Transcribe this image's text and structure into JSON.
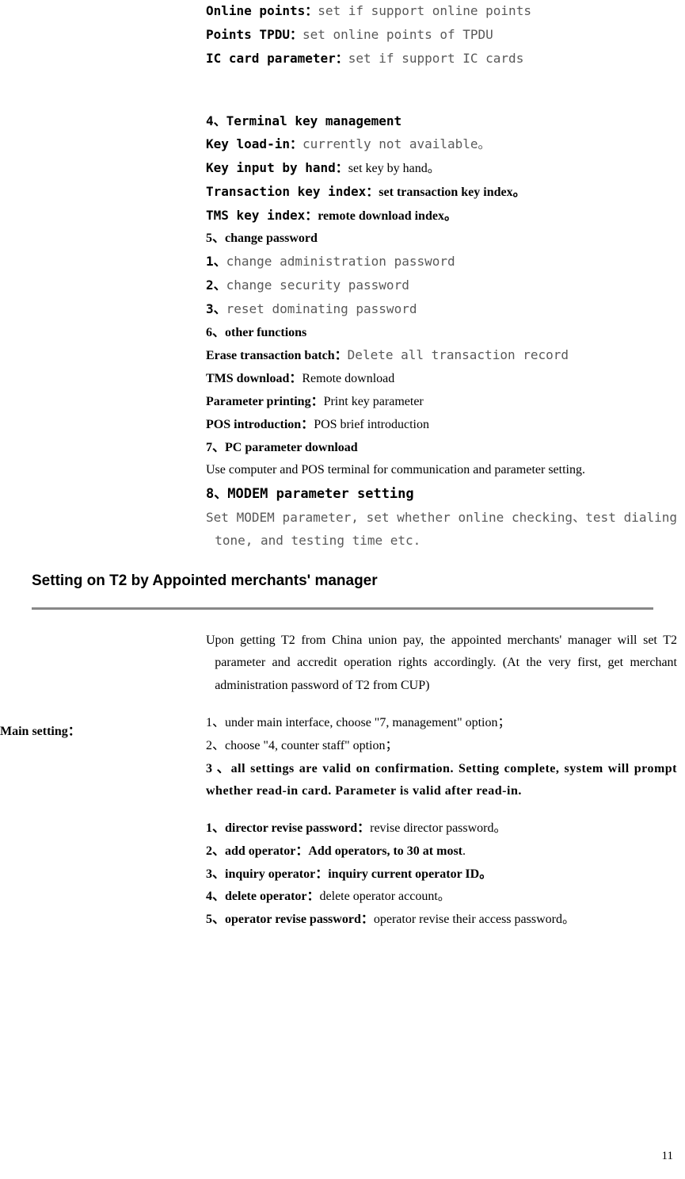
{
  "top": {
    "online_points_label": "Online points：",
    "online_points_desc": "set if support online points",
    "points_tpdu_label": "Points TPDU：",
    "points_tpdu_desc": "set online points of TPDU",
    "ic_card_label": "IC card parameter：",
    "ic_card_desc": "set if support IC cards"
  },
  "s4": {
    "heading": "4、Terminal key management",
    "key_loadin_label": "Key load-in：",
    "key_loadin_desc": "currently not available。",
    "key_input_label": "Key input by hand：",
    "key_input_desc": "set key by hand。",
    "txn_key_index_label": "Transaction key index：",
    "txn_key_index_desc": "set transaction key index。",
    "tms_key_index_label": "TMS key index：",
    "tms_key_index_desc": "remote download index。"
  },
  "s5": {
    "heading": "5、change password",
    "item1_num": "1、",
    "item1_desc": "change administration password",
    "item2_num": "2、",
    "item2_desc": "change security password",
    "item3_num": "3、",
    "item3_desc": "reset dominating password"
  },
  "s6": {
    "heading": "6、other functions",
    "erase_label": "Erase transaction batch：",
    "erase_desc": "Delete all transaction record",
    "tms_label": "TMS download：",
    "tms_desc": "Remote download",
    "param_label": "Parameter printing：",
    "param_desc": "Print key parameter",
    "pos_label": "POS introduction：",
    "pos_desc": "POS brief introduction"
  },
  "s7": {
    "heading": "7、PC parameter download",
    "desc": "Use computer and POS terminal for communication and parameter setting."
  },
  "s8": {
    "heading": "8、MODEM parameter setting",
    "desc": "Set MODEM parameter, set whether online checking、test dialing tone, and testing time etc."
  },
  "manager": {
    "heading": "Setting on T2 by Appointed merchants' manager",
    "intro": "Upon getting T2 from China union pay, the appointed merchants' manager will set T2 parameter and accredit operation rights accordingly. (At the very first, get merchant administration password of T2 from CUP)",
    "left_label": "Main setting：",
    "step1": "1、under main interface, choose \"7, management\" option；",
    "step2": "2、choose \"4, counter staff\" option；",
    "step3a": "3",
    "step3b": "、all settings are valid on confirmation. Setting complete, system will prompt whether read-in card. Parameter is valid after read-in.",
    "op1_label": "1、director revise password：",
    "op1_desc": "revise director password。",
    "op2_label": "2、add operator：",
    "op2_desc": "Add operators, to 30 at most",
    "op2_period": ".",
    "op3_label": "3、inquiry operator：",
    "op3_desc": "inquiry current operator ID。",
    "op4_label": "4、delete operator：",
    "op4_desc": "delete operator account。",
    "op5_label": "5、operator revise password：",
    "op5_desc": "operator revise their access password。"
  },
  "pagenum": "11"
}
